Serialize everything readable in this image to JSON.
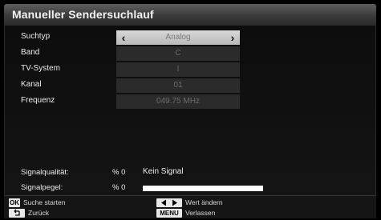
{
  "title": "Manueller Sendersuchlauf",
  "fields": [
    {
      "label": "Suchtyp",
      "value": "Analog"
    },
    {
      "label": "Band",
      "value": "C"
    },
    {
      "label": "TV-System",
      "value": "I"
    },
    {
      "label": "Kanal",
      "value": "01"
    },
    {
      "label": "Frequenz",
      "value": "049.75 MHz"
    }
  ],
  "signal": {
    "quality_label": "Signalqualität:",
    "quality_value": "% 0",
    "quality_status": "Kein Signal",
    "level_label": "Signalpegel:",
    "level_value": "% 0",
    "level_bar_fraction": 1.0
  },
  "footer": {
    "ok_key": "OK",
    "ok_text": "Suche starten",
    "back_text": "Zurück",
    "lr_text": "Wert ändern",
    "menu_key": "MENU",
    "menu_text": "Verlassen"
  },
  "icons": {
    "back_key": "back-arrow-icon",
    "lr_keys": "left-right-arrows-icon"
  },
  "colors": {
    "selected_row": "#c8c8c8",
    "value_box": "#2b2b2b",
    "value_text": "#6c6c6c",
    "title_bar": "#4a4a4a"
  }
}
